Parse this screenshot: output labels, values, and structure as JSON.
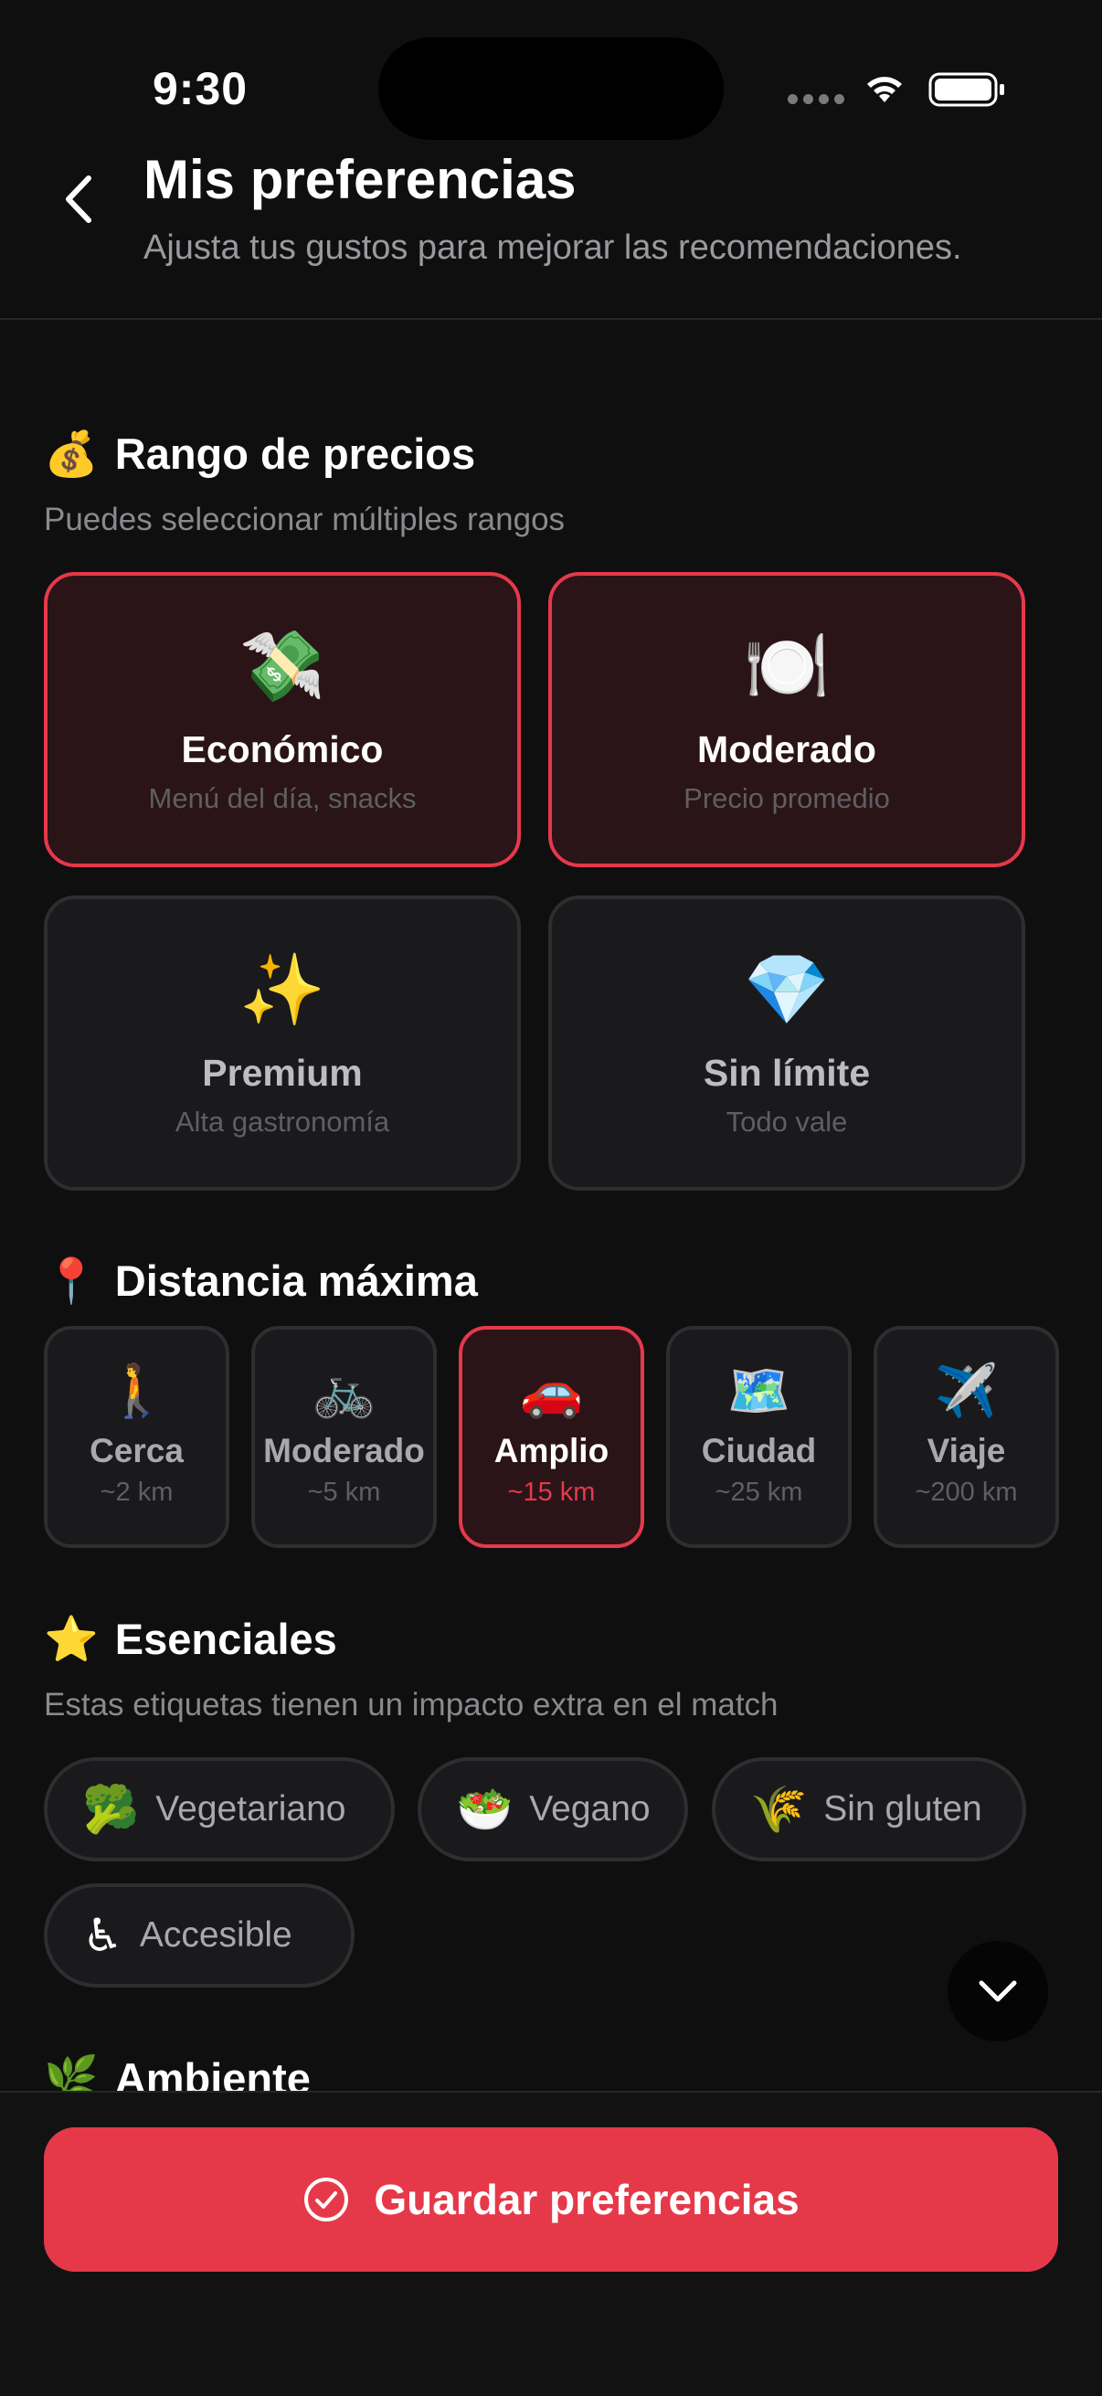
{
  "status_bar": {
    "time": "9:30"
  },
  "header": {
    "title": "Mis preferencias",
    "subtitle": "Ajusta tus gustos para mejorar las recomendaciones."
  },
  "price_section": {
    "emoji": "💰",
    "title": "Rango de precios",
    "description": "Puedes seleccionar múltiples rangos",
    "options": [
      {
        "emoji": "💸",
        "label": "Económico",
        "desc": "Menú del día, snacks",
        "selected": true
      },
      {
        "emoji": "🍽️",
        "label": "Moderado",
        "desc": "Precio promedio",
        "selected": true
      },
      {
        "emoji": "✨",
        "label": "Premium",
        "desc": "Alta gastronomía",
        "selected": false
      },
      {
        "emoji": "💎",
        "label": "Sin límite",
        "desc": "Todo vale",
        "selected": false
      }
    ]
  },
  "distance_section": {
    "emoji": "📍",
    "title": "Distancia máxima",
    "options": [
      {
        "emoji": "🚶",
        "label": "Cerca",
        "desc": "~2 km",
        "selected": false
      },
      {
        "emoji": "🚲",
        "label": "Moderado",
        "desc": "~5 km",
        "selected": false
      },
      {
        "emoji": "🚗",
        "label": "Amplio",
        "desc": "~15 km",
        "selected": true
      },
      {
        "emoji": "🗺️",
        "label": "Ciudad",
        "desc": "~25 km",
        "selected": false
      },
      {
        "emoji": "✈️",
        "label": "Viaje",
        "desc": "~200 km",
        "selected": false
      }
    ]
  },
  "essentials_section": {
    "emoji": "⭐",
    "title": "Esenciales",
    "description": "Estas etiquetas tienen un impacto extra en el match",
    "chips": [
      {
        "emoji": "🥦",
        "label": "Vegetariano"
      },
      {
        "emoji": "🥗",
        "label": "Vegano"
      },
      {
        "emoji": "🌾",
        "label": "Sin gluten"
      },
      {
        "emoji": "♿",
        "label": "Accesible"
      }
    ]
  },
  "ambient_section": {
    "emoji": "🌿",
    "title": "Ambiente"
  },
  "footer": {
    "save_label": "Guardar preferencias"
  },
  "colors": {
    "accent": "#e5394a",
    "background": "#0f0f10",
    "card": "#1a1a1c",
    "selected_card": "#2a1418"
  }
}
